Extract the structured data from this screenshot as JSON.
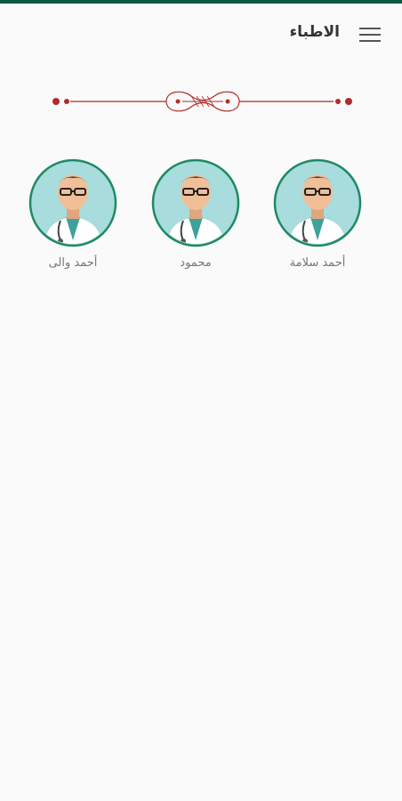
{
  "header": {
    "title": "الاطباء",
    "menu_icon": "hamburger-menu-icon"
  },
  "doctors": [
    {
      "name": "أحمد سلامة"
    },
    {
      "name": "محمود"
    },
    {
      "name": "أحمد والى"
    }
  ],
  "colors": {
    "status_bar": "#0f5a3c",
    "avatar_ring": "#1e8a63",
    "avatar_bg": "#a9dcdc",
    "ornament": "#b22b2b"
  }
}
